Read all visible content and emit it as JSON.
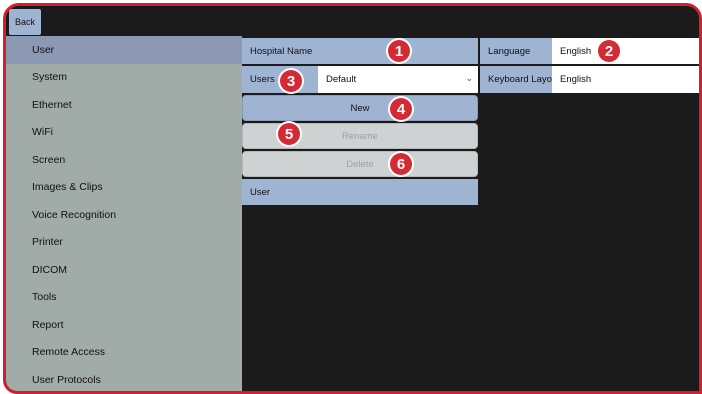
{
  "topbar": {
    "back_label": "Back"
  },
  "sidebar": {
    "items": [
      {
        "label": "User"
      },
      {
        "label": "System"
      },
      {
        "label": "Ethernet"
      },
      {
        "label": "WiFi"
      },
      {
        "label": "Screen"
      },
      {
        "label": "Images & Clips"
      },
      {
        "label": "Voice Recognition"
      },
      {
        "label": "Printer"
      },
      {
        "label": "DICOM"
      },
      {
        "label": "Tools"
      },
      {
        "label": "Report"
      },
      {
        "label": "Remote Access"
      },
      {
        "label": "User Protocols"
      }
    ],
    "active": "User"
  },
  "settings": {
    "hospital_name_label": "Hospital Name",
    "hospital_name_value": "",
    "users_label": "Users",
    "users_selected": "Default",
    "new_button": "New",
    "rename_button": "Rename",
    "delete_button": "Delete",
    "user_list_item": "User",
    "language_label": "Language",
    "language_value": "English",
    "keyboard_layout_label": "Keyboard Layout",
    "keyboard_layout_value": "English"
  },
  "callouts": [
    "1",
    "2",
    "3",
    "4",
    "5",
    "6"
  ],
  "colors": {
    "accent_red": "#d11f2f",
    "button_blue": "#9eb4d2",
    "sidebar_gray": "#a1aba8",
    "sidebar_active": "#8c99b4",
    "disabled_gray": "#cfd2d2",
    "background_dark": "#1b1b1b"
  }
}
